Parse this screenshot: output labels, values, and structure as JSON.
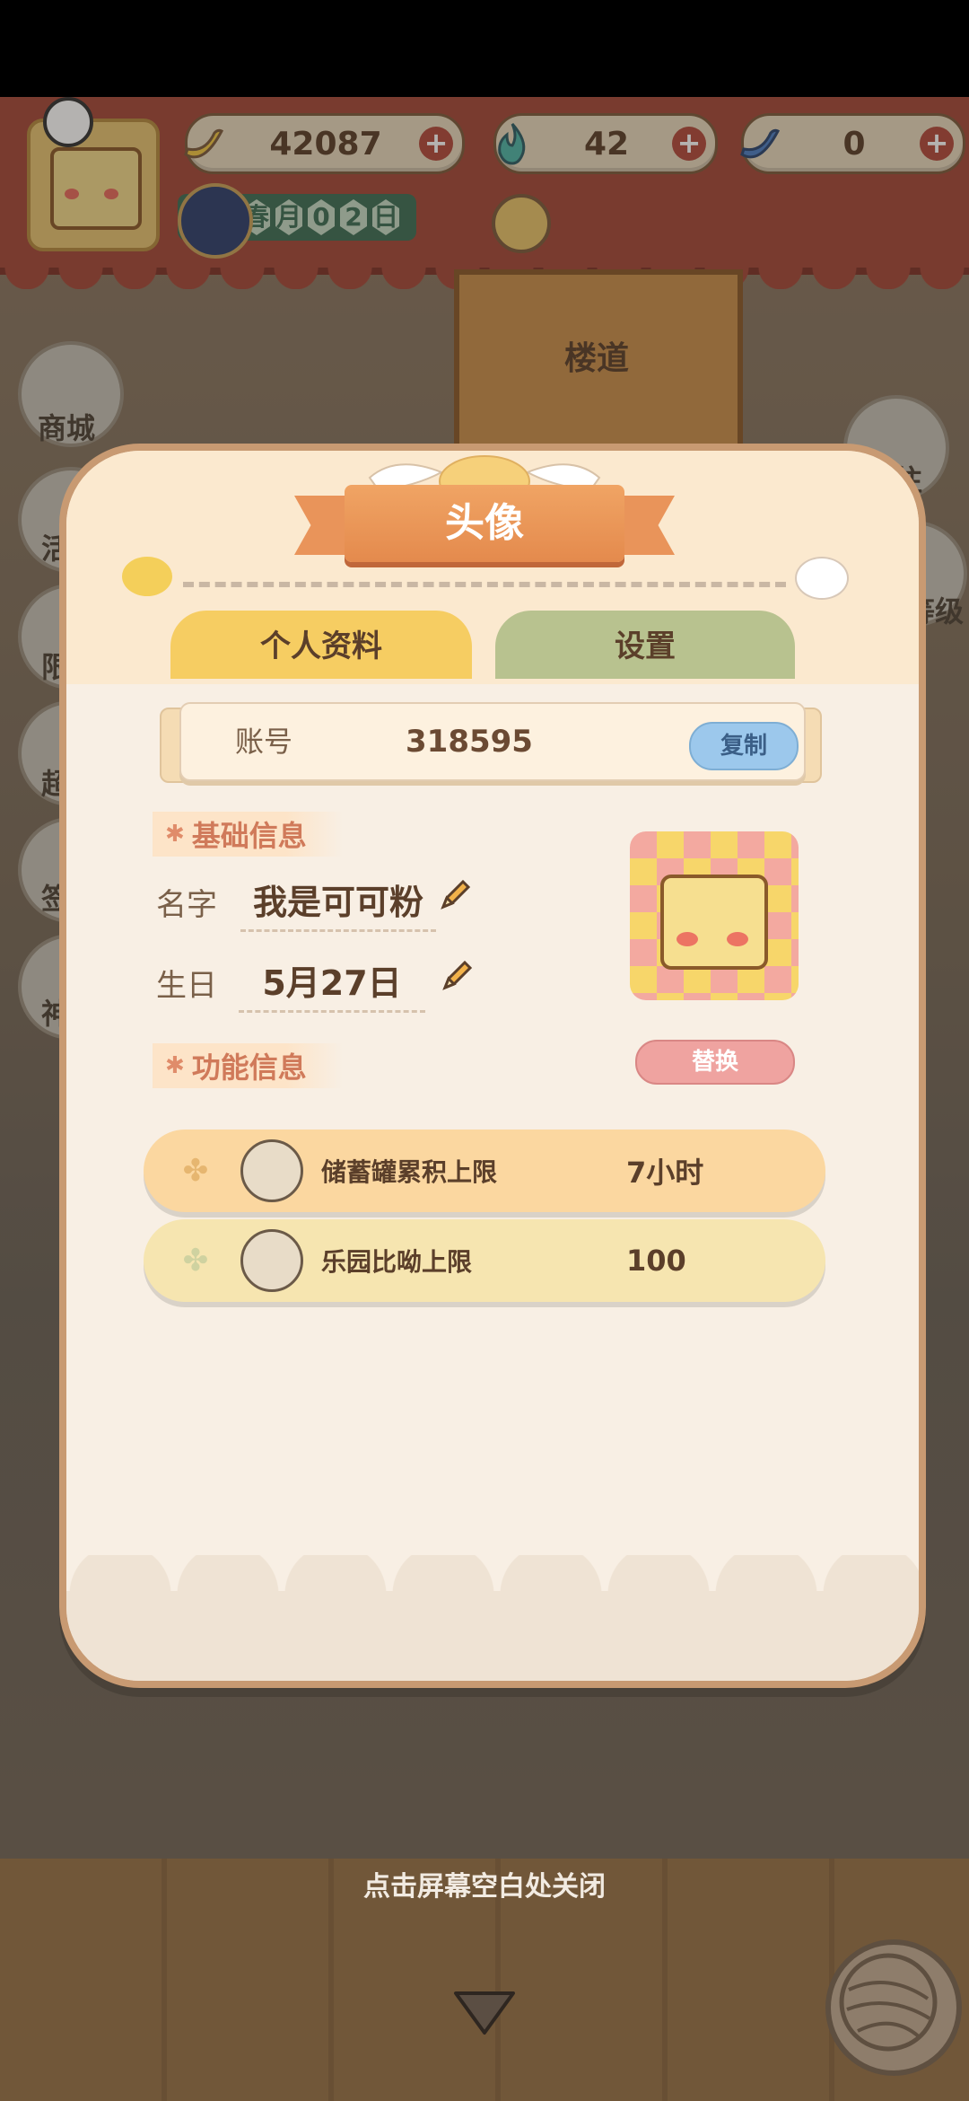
{
  "top_bar": {
    "currencies": [
      {
        "icon": "banana-icon",
        "value": "42087"
      },
      {
        "icon": "blue-flame-icon",
        "value": "42"
      },
      {
        "icon": "blue-banana-icon",
        "value": "0"
      }
    ],
    "plus_glyph": "+",
    "date_chars": [
      "春",
      "月",
      "0",
      "2",
      "日"
    ]
  },
  "background": {
    "building_label": "楼道",
    "left_buttons": [
      "商城",
      "活",
      "限",
      "超",
      "签",
      "神"
    ],
    "right_buttons": [
      "前往",
      "等级"
    ]
  },
  "modal": {
    "title": "头像",
    "tabs": {
      "profile": "个人资料",
      "settings": "设置"
    },
    "account": {
      "label": "账号",
      "value": "318595",
      "copy_label": "复制"
    },
    "basic_section": "基础信息",
    "name": {
      "label": "名字",
      "value": "我是可可粉"
    },
    "birthday": {
      "label": "生日",
      "value": "5月27日"
    },
    "replace_label": "替换",
    "function_section": "功能信息",
    "section_star": "✱",
    "features": [
      {
        "name": "储蓄罐累积上限",
        "value": "7小时"
      },
      {
        "name": "乐园比呦上限",
        "value": "100"
      }
    ]
  },
  "close_hint": "点击屏幕空白处关闭",
  "colors": {
    "accent": "#e48a4d",
    "tab_active": "#f6cd62",
    "tab_inactive": "#b8c28f",
    "copy_button": "#9cc8ec",
    "replace_button": "#efa3a0"
  }
}
